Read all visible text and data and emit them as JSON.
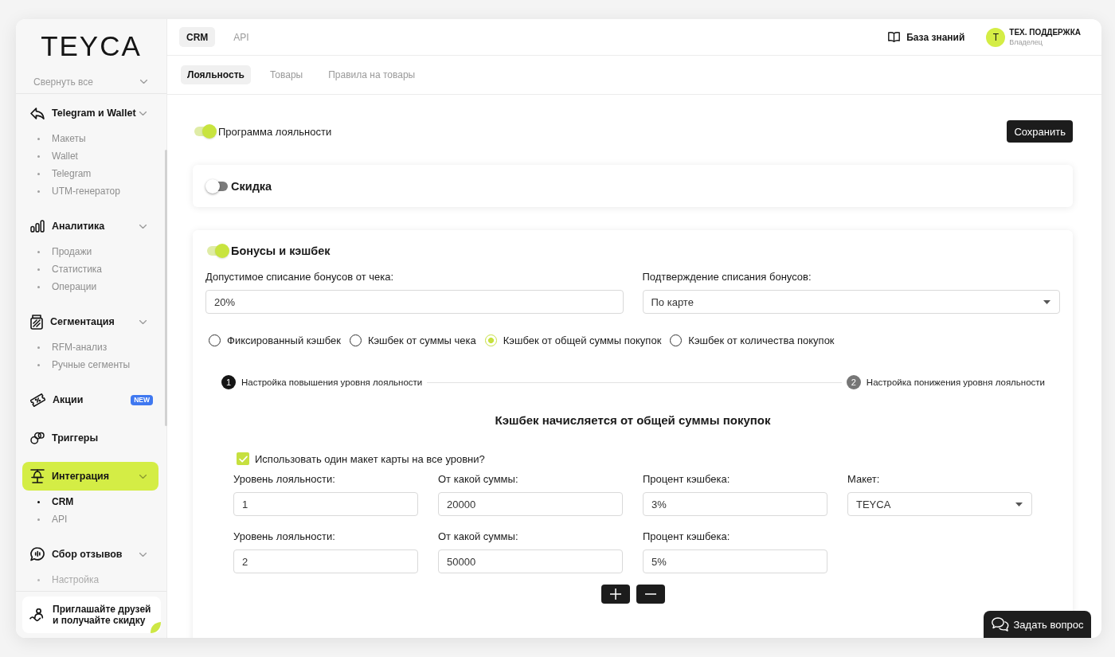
{
  "sidebar": {
    "logo": "TEYCA",
    "collapse_all": "Свернуть все",
    "groups": [
      {
        "label": "Telegram и Wallet",
        "selected": false,
        "children": [
          {
            "label": "Макеты",
            "selected": false
          },
          {
            "label": "Wallet",
            "selected": false
          },
          {
            "label": "Telegram",
            "selected": false
          },
          {
            "label": "UTM-генератор",
            "selected": false
          }
        ]
      },
      {
        "label": "Аналитика",
        "selected": false,
        "children": [
          {
            "label": "Продажи",
            "selected": false
          },
          {
            "label": "Статистика",
            "selected": false
          },
          {
            "label": "Операции",
            "selected": false
          }
        ]
      },
      {
        "label": "Сегментация",
        "selected": false,
        "children": [
          {
            "label": "RFM-анализ",
            "selected": false
          },
          {
            "label": "Ручные сегменты",
            "selected": false
          }
        ]
      },
      {
        "label": "Акции",
        "selected": false,
        "badge": "NEW"
      },
      {
        "label": "Триггеры",
        "selected": false
      },
      {
        "label": "Интеграция",
        "selected": true,
        "children": [
          {
            "label": "CRM",
            "selected": true
          },
          {
            "label": "API",
            "selected": false
          }
        ]
      },
      {
        "label": "Сбор отзывов",
        "selected": false,
        "children": [
          {
            "label": "Настройка",
            "selected": false
          }
        ]
      }
    ],
    "promo": "Приглашайте друзей и получайте скидку"
  },
  "topbar": {
    "tabs": [
      {
        "label": "CRM",
        "selected": true
      },
      {
        "label": "API",
        "selected": false
      }
    ],
    "knowledge_base": "База знаний",
    "user": {
      "initial": "Т",
      "name": "ТЕХ. ПОДДЕРЖКА",
      "role": "Владелец"
    }
  },
  "subtabs": [
    {
      "label": "Лояльность",
      "selected": true
    },
    {
      "label": "Товары",
      "selected": false
    },
    {
      "label": "Правила на товары",
      "selected": false
    }
  ],
  "loyalty_program": {
    "label": "Программа лояльности",
    "on": true
  },
  "save_button": "Сохранить",
  "discount": {
    "title": "Скидка",
    "on": false
  },
  "bonuses": {
    "title": "Бонусы и кэшбек",
    "on": true,
    "fields": [
      {
        "kind": "input",
        "label": "Допустимое списание бонусов от чека:",
        "value": "20%"
      },
      {
        "kind": "select",
        "label": "Подтверждение списания бонусов:",
        "value": "По карте"
      }
    ],
    "cashback_modes": [
      {
        "label": "Фиксированный кэшбек",
        "selected": false
      },
      {
        "label": "Кэшбек от суммы чека",
        "selected": false
      },
      {
        "label": "Кэшбек от общей суммы покупок",
        "selected": true
      },
      {
        "label": "Кэшбек от количества покупок",
        "selected": false
      }
    ],
    "steps": [
      {
        "number": "1",
        "label": "Настройка повышения уровня лояльности",
        "selected": true
      },
      {
        "number": "2",
        "label": "Настройка понижения уровня лояльности",
        "selected": false
      }
    ],
    "heading": "Кэшбек начисляется от общей суммы покупок",
    "same_layout": {
      "label": "Использовать один макет карты на все уровни?",
      "checked": true
    },
    "levels": [
      {
        "fields": [
          {
            "kind": "input",
            "label": "Уровень лояльности:",
            "value": "1"
          },
          {
            "kind": "input",
            "label": "От какой суммы:",
            "value": "20000"
          },
          {
            "kind": "input",
            "label": "Процент кэшбека:",
            "value": "3%"
          },
          {
            "kind": "select",
            "label": "Макет:",
            "value": "TEYCA"
          }
        ]
      },
      {
        "fields": [
          {
            "kind": "input",
            "label": "Уровень лояльности:",
            "value": "2"
          },
          {
            "kind": "input",
            "label": "От какой суммы:",
            "value": "50000"
          },
          {
            "kind": "input",
            "label": "Процент кэшбека:",
            "value": "5%"
          }
        ]
      }
    ]
  },
  "help_button": "Задать вопрос"
}
